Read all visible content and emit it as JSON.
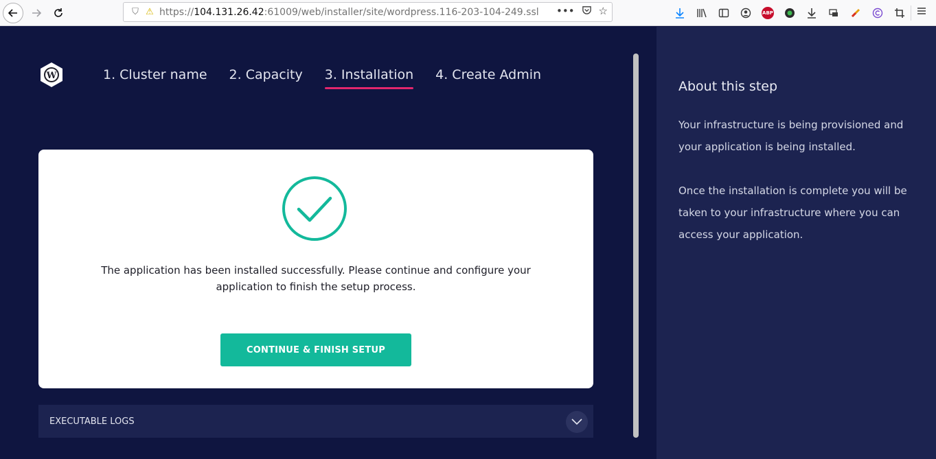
{
  "browser": {
    "url_prefix": "https://",
    "url_host": "104.131.26.42",
    "url_rest": ":61009/web/installer/site/wordpress.116-203-104-249.ssl",
    "url_more": "•••",
    "icons": [
      "download-icon",
      "library-icon",
      "sidebar-icon",
      "account-icon",
      "adblock-icon",
      "extension-icon",
      "download-arrow-icon",
      "screenshot-icon",
      "link-icon",
      "c-icon",
      "crop-icon",
      "menu-icon"
    ],
    "abp_label": "ABP"
  },
  "steps": [
    {
      "label": "1. Cluster name",
      "active": false
    },
    {
      "label": "2. Capacity",
      "active": false
    },
    {
      "label": "3. Installation",
      "active": true
    },
    {
      "label": "4. Create Admin",
      "active": false
    }
  ],
  "card": {
    "message_line1": "The application has been installed successfully. Please continue and configure your",
    "message_line2": "application to finish the setup process.",
    "button_label": "CONTINUE & FINISH SETUP"
  },
  "logs": {
    "label": "EXECUTABLE LOGS"
  },
  "about": {
    "title": "About this step",
    "paragraph1": "Your infrastructure is being provisioned and your application is being installed.",
    "paragraph2": "Once the installation is complete you will be taken to your infrastructure where you can access your application."
  },
  "colors": {
    "background": "#0f1540",
    "side_panel": "#1c2350",
    "accent_active": "#e2266d",
    "success": "#13b99b"
  }
}
